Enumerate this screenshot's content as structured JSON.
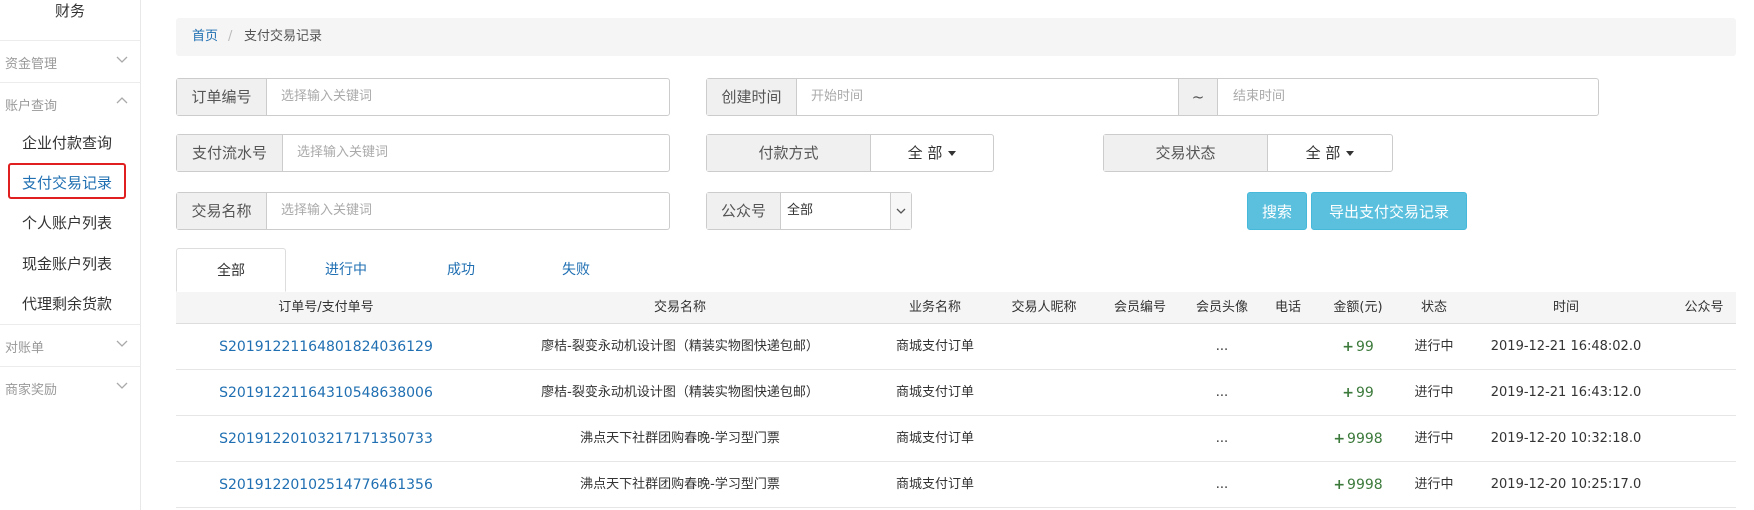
{
  "sidebar": {
    "title": "财务",
    "groups": [
      {
        "label": "资金管理"
      },
      {
        "label": "账户查询"
      },
      {
        "label": "对账单"
      },
      {
        "label": "商家奖励"
      }
    ],
    "items": [
      {
        "label": "企业付款查询"
      },
      {
        "label": "支付交易记录"
      },
      {
        "label": "个人账户列表"
      },
      {
        "label": "现金账户列表"
      },
      {
        "label": "代理剩余货款"
      }
    ]
  },
  "breadcrumb": {
    "home": "首页",
    "separator": "/",
    "current": "支付交易记录"
  },
  "filters": {
    "order_no": {
      "label": "订单编号",
      "placeholder": "选择输入关键词"
    },
    "create_time": {
      "label": "创建时间",
      "start_placeholder": "开始时间",
      "tilde": "~",
      "end_placeholder": "结束时间"
    },
    "pay_serial": {
      "label": "支付流水号",
      "placeholder": "选择输入关键词"
    },
    "pay_method": {
      "label": "付款方式",
      "value": "全 部"
    },
    "trade_status": {
      "label": "交易状态",
      "value": "全 部"
    },
    "trade_name": {
      "label": "交易名称",
      "placeholder": "选择输入关键词"
    },
    "official_account": {
      "label": "公众号",
      "value": "全部"
    },
    "search_button": "搜索",
    "export_button": "导出支付交易记录"
  },
  "tabs": [
    "全部",
    "进行中",
    "成功",
    "失败"
  ],
  "table": {
    "headers": [
      "订单号/支付单号",
      "交易名称",
      "业务名称",
      "交易人昵称",
      "会员编号",
      "会员头像",
      "电话",
      "金额(元)",
      "状态",
      "时间",
      "公众号"
    ],
    "rows": [
      {
        "order": "S20191221164801824036129",
        "name": "廖桔-裂变永动机设计图（精装实物图快递包邮）",
        "biz": "商城支付订单",
        "avatar": "...",
        "amount": "99",
        "status": "进行中",
        "time": "2019-12-21 16:48:02.0"
      },
      {
        "order": "S20191221164310548638006",
        "name": "廖桔-裂变永动机设计图（精装实物图快递包邮）",
        "biz": "商城支付订单",
        "avatar": "...",
        "amount": "99",
        "status": "进行中",
        "time": "2019-12-21 16:43:12.0"
      },
      {
        "order": "S20191220103217171350733",
        "name": "沸点天下社群团购春晚-学习型门票",
        "biz": "商城支付订单",
        "avatar": "...",
        "amount": "9998",
        "status": "进行中",
        "time": "2019-12-20 10:32:18.0"
      },
      {
        "order": "S20191220102514776461356",
        "name": "沸点天下社群团购春晚-学习型门票",
        "biz": "商城支付订单",
        "avatar": "...",
        "amount": "9998",
        "status": "进行中",
        "time": "2019-12-20 10:25:17.0"
      }
    ]
  },
  "colors": {
    "link": "#1f6fb2",
    "button": "#5bc0de",
    "highlight_box": "#e02020",
    "amount": "#3c7a3c"
  }
}
